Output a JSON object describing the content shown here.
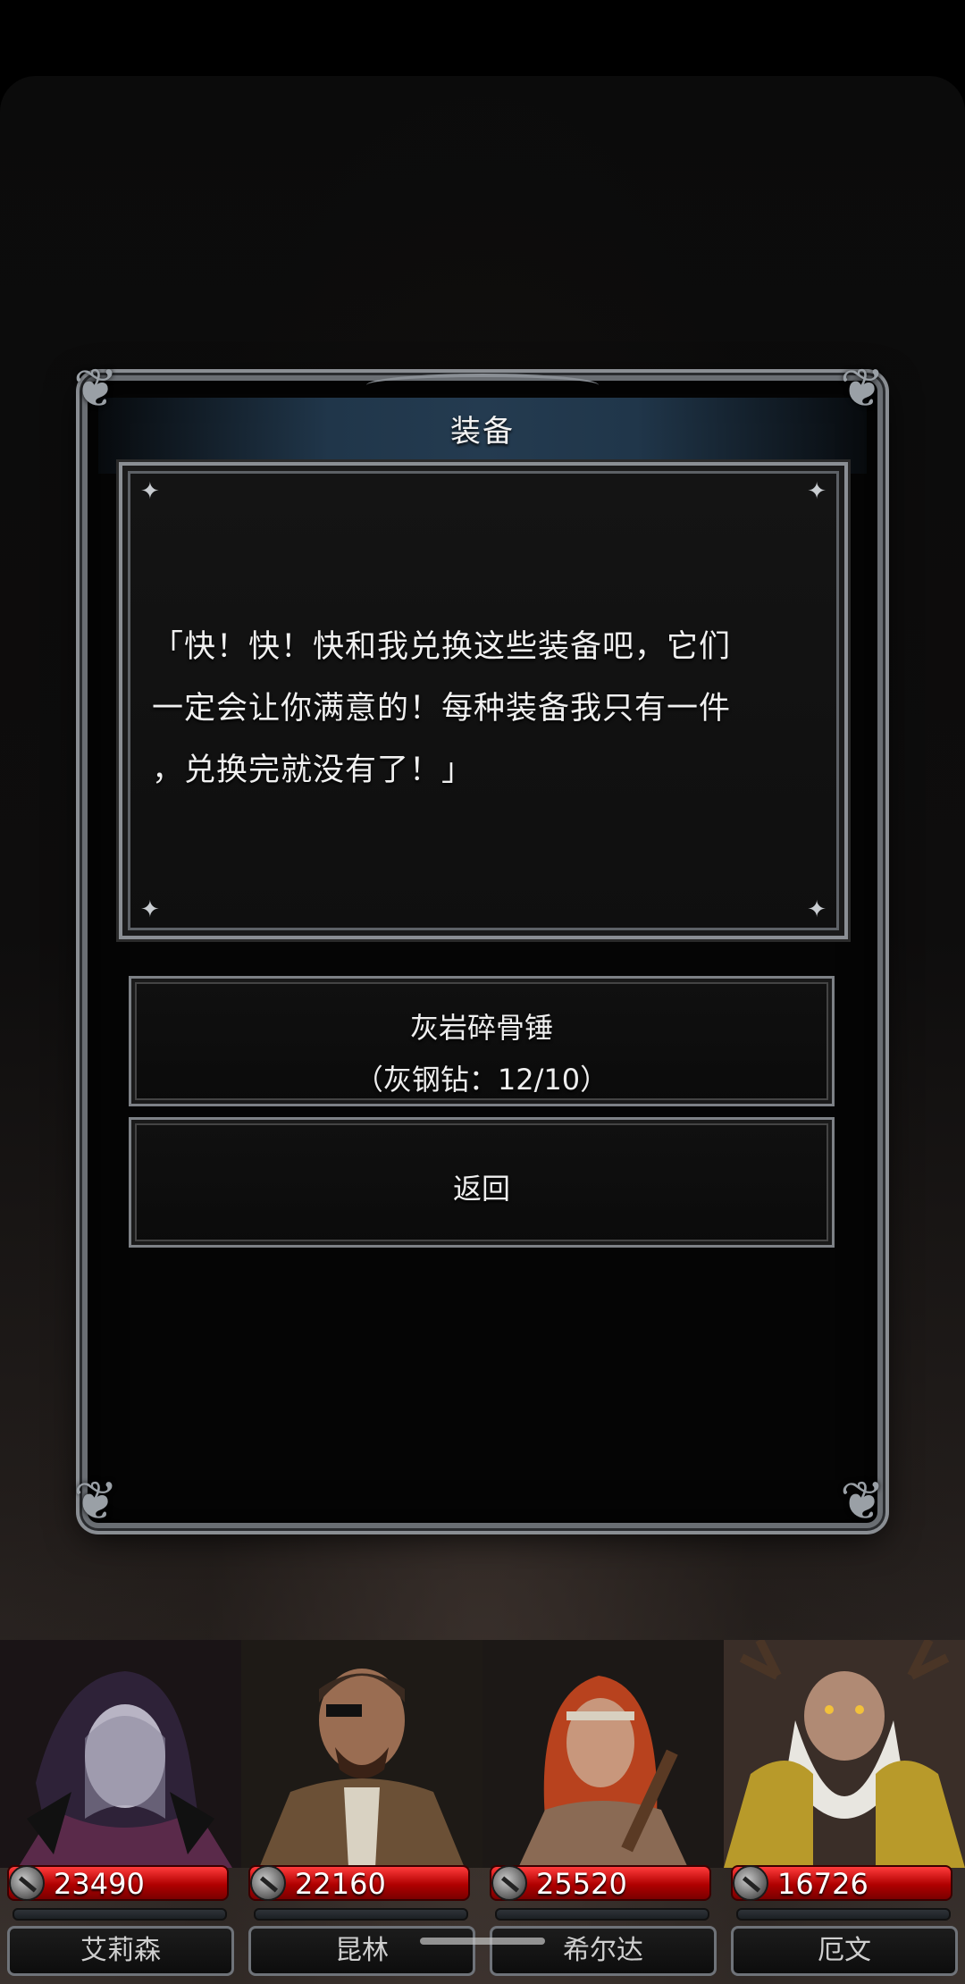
{
  "dialog": {
    "title": "装备",
    "lines": [
      "「快！快！快和我兑换这些装备吧，它们",
      "一定会让你满意的！每种装备我只有一件",
      "，兑换完就没有了！」"
    ]
  },
  "options": [
    {
      "line1": "灰岩碎骨锤",
      "line2": "（灰钢钻：12/10）"
    },
    {
      "label": "返回"
    }
  ],
  "party": [
    {
      "name": "艾莉森",
      "hp": "23490",
      "icon": "sword-icon"
    },
    {
      "name": "昆林",
      "hp": "22160",
      "icon": "sword-icon"
    },
    {
      "name": "希尔达",
      "hp": "25520",
      "icon": "sword-icon"
    },
    {
      "name": "厄文",
      "hp": "16726",
      "icon": "sword-icon"
    }
  ],
  "colors": {
    "hp_red": "#c40000",
    "panel_border": "#6a6e73",
    "title_bar": "#243b50"
  }
}
